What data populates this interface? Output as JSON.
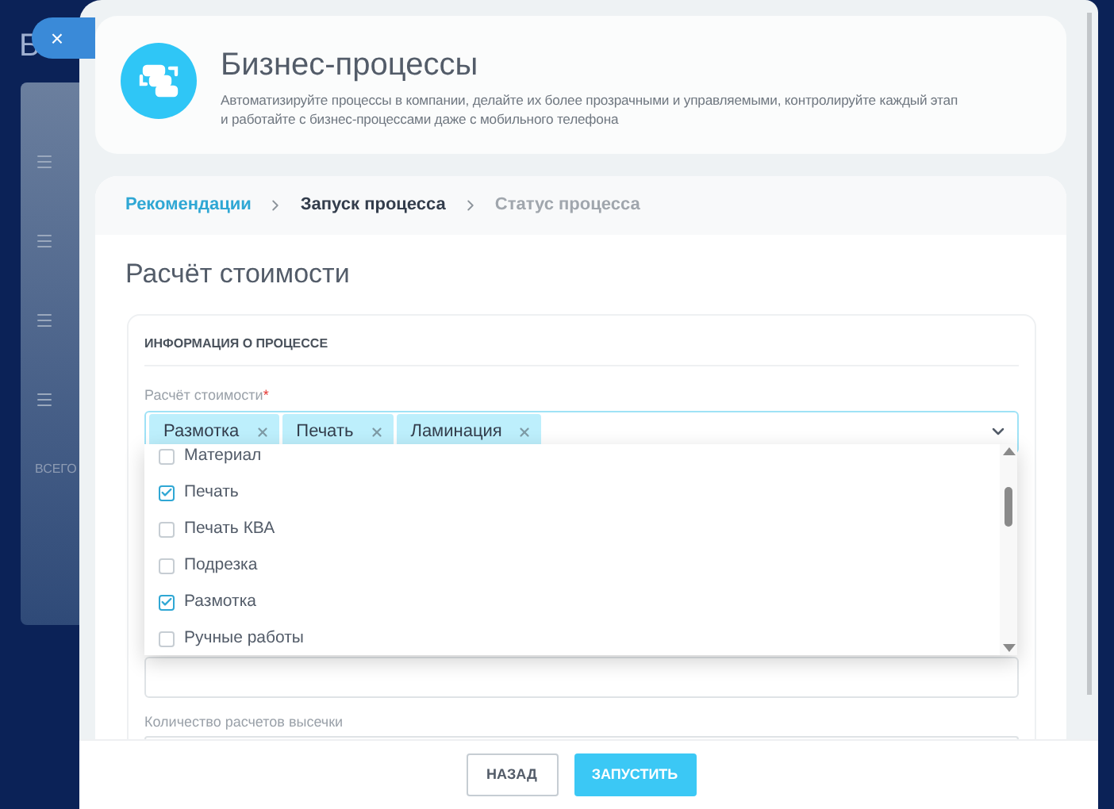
{
  "background": {
    "letter": "Б",
    "total_label": "ВСЕГО"
  },
  "close_button": {
    "label": "×"
  },
  "header": {
    "title": "Бизнес-процессы",
    "description": "Автоматизируйте процессы в компании, делайте их более прозрачными и управляемыми, контролируйте каждый этап и работайте с бизнес-процессами даже с мобильного телефона"
  },
  "breadcrumbs": [
    {
      "label": "Рекомендации",
      "kind": "link"
    },
    {
      "label": "Запуск процесса",
      "kind": "current"
    },
    {
      "label": "Статус процесса",
      "kind": "pending"
    }
  ],
  "page_title": "Расчёт стоимости",
  "section_title": "ИНФОРМАЦИЯ О ПРОЦЕССЕ",
  "cost_field": {
    "label": "Расчёт стоимости",
    "required_mark": "*",
    "expanded": true,
    "tags": [
      {
        "label": "Размотка"
      },
      {
        "label": "Печать"
      },
      {
        "label": "Ламинация"
      }
    ],
    "options": [
      {
        "label": "Материал",
        "checked": false
      },
      {
        "label": "Печать",
        "checked": true
      },
      {
        "label": "Печать КВА",
        "checked": false
      },
      {
        "label": "Подрезка",
        "checked": false
      },
      {
        "label": "Размотка",
        "checked": true
      },
      {
        "label": "Ручные работы",
        "checked": false
      }
    ]
  },
  "cut_field": {
    "label": "Количество расчетов высечки"
  },
  "buttons": [
    {
      "label": "НАЗАД",
      "kind": "secondary"
    },
    {
      "label": "ЗАПУСТИТЬ",
      "kind": "primary"
    }
  ]
}
